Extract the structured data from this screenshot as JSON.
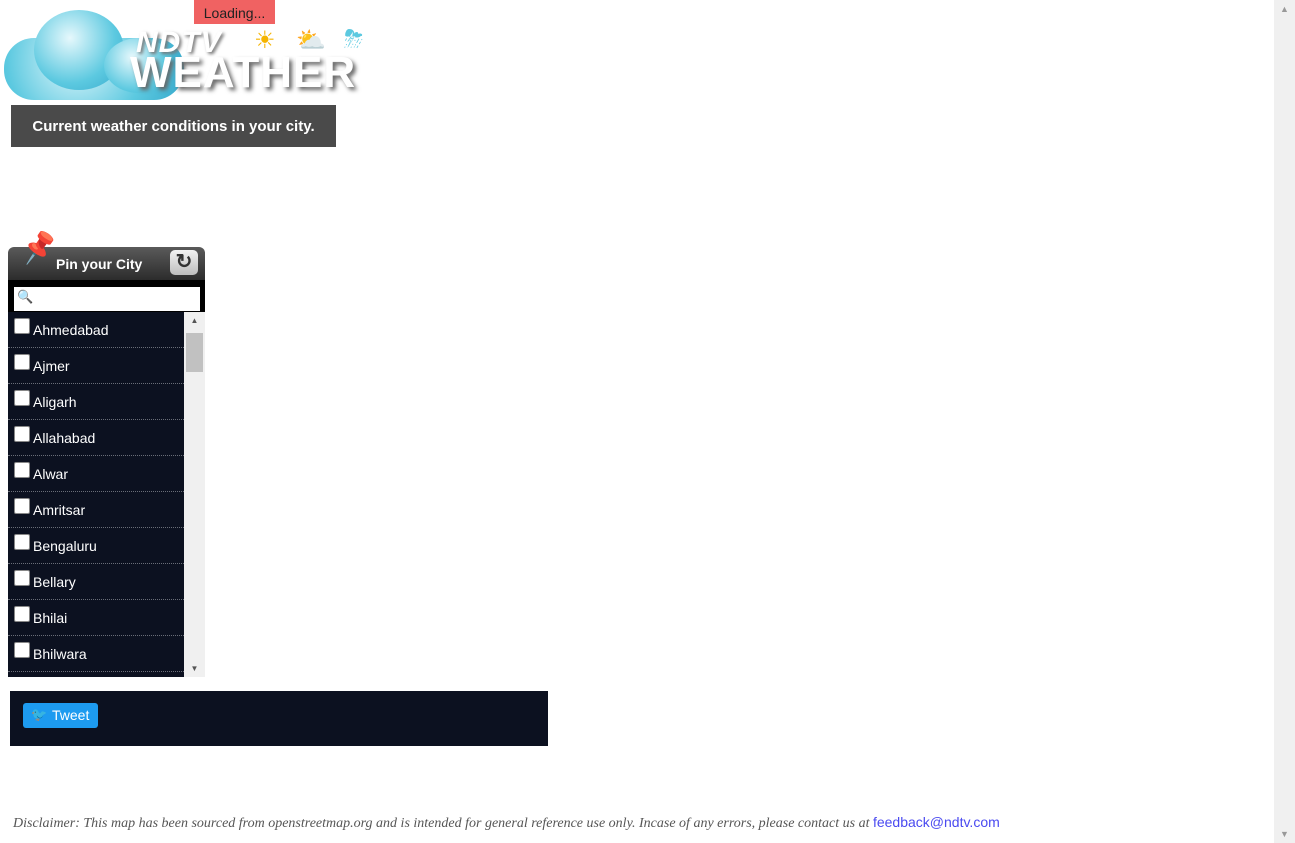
{
  "loading": "Loading...",
  "logo": {
    "line1": "NDTV",
    "line2": "WEATHER"
  },
  "subtitle": "Current weather conditions in your city.",
  "pin_panel": {
    "title": "Pin your City",
    "search_placeholder": "",
    "cities": [
      "Ahmedabad",
      "Ajmer",
      "Aligarh",
      "Allahabad",
      "Alwar",
      "Amritsar",
      "Bengaluru",
      "Bellary",
      "Bhilai",
      "Bhilwara",
      ""
    ]
  },
  "tweet": {
    "label": "Tweet"
  },
  "disclaimer": {
    "text": "Disclaimer: This map has been sourced from openstreetmap.org and is intended for general reference use only. Incase of any errors, please contact us at ",
    "email": "feedback@ndtv.com"
  },
  "colors": {
    "panel_bg": "#0c1120",
    "tweet": "#1d9bf0",
    "loading": "#f06262",
    "subtitle_bg": "#4a4a4a"
  }
}
